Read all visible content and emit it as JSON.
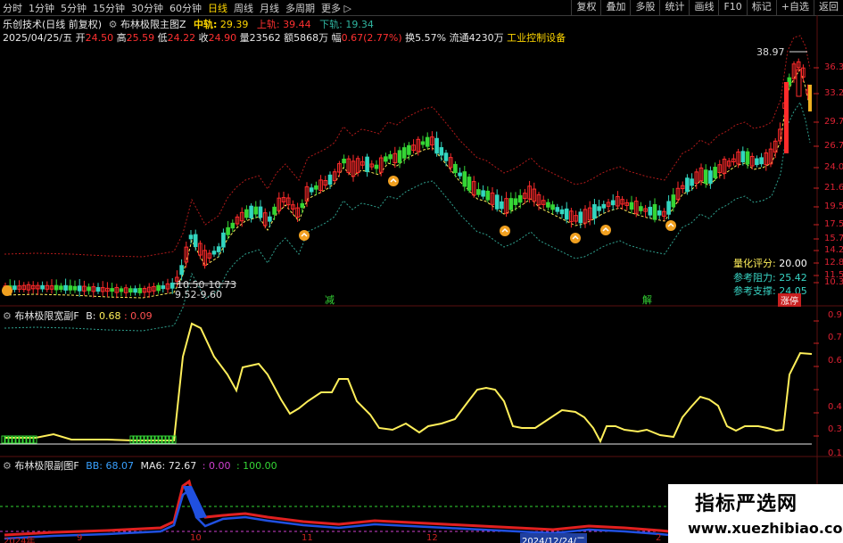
{
  "toolbar": {
    "periods": [
      "分时",
      "1分钟",
      "5分钟",
      "15分钟",
      "30分钟",
      "60分钟",
      "日线",
      "周线",
      "月线",
      "多周期",
      "更多 ▷"
    ],
    "active_index": 6,
    "actions": [
      "复权",
      "叠加",
      "多股",
      "统计",
      "画线",
      "F10",
      "标记",
      "+自选",
      "返回"
    ]
  },
  "main_header": {
    "stock": "乐创技术(日线 前复权)",
    "indicator": "布林极限主图Z",
    "mid_label": "中轨:",
    "mid_value": "29.39",
    "upper_label": "上轨:",
    "upper_value": "39.44",
    "lower_label": "下轨:",
    "lower_value": "19.34"
  },
  "quote_line": {
    "date": "2025/04/25/五",
    "open_label": "开",
    "open": "24.50",
    "high_label": "高",
    "high": "25.59",
    "low_label": "低",
    "low": "24.22",
    "close_label": "收",
    "close": "24.90",
    "vol_label": "量",
    "vol": "23562",
    "amt_label": "额",
    "amt": "5868万",
    "chg_label": "幅",
    "chg": "0.67",
    "chg_pct": "(2.77%)",
    "turnover_label": "换",
    "turnover": "5.57%",
    "float_label": "流通",
    "float_shares": "4230万",
    "industry": "工业控制设备"
  },
  "main_axis": [
    "36.3",
    "33.2",
    "29.7",
    "26.7",
    "24.0",
    "21.6",
    "19.5",
    "17.5",
    "15.7",
    "14.2",
    "12.8",
    "11.5",
    "10.3"
  ],
  "main_labels": {
    "peak": "38.97",
    "low_zone_a": "10.50-10.73",
    "low_zone_b": "9.52-9.60",
    "score_label": "量化评分:",
    "score_value": "20.00",
    "resist_label": "参考阻力:",
    "resist_value": "25.42",
    "support_label": "参考支撑:",
    "support_value": "24.05",
    "jian": "减",
    "jie": "解",
    "zhangting": "涨停"
  },
  "sub1_header": {
    "indicator": "布林极限宽副F",
    "b_label": "B:",
    "b_value": "0.68",
    "second_value": ": 0.09"
  },
  "sub1_axis": [
    "0.9",
    "0.7",
    "0.6",
    "0.4",
    "0.3",
    "0.1"
  ],
  "sub2_header": {
    "indicator": "布林极限副图F",
    "bb_label": "BB:",
    "bb_value": "68.07",
    "ma_label": "MA6:",
    "ma_value": "72.67",
    "v0": ": 0.00",
    "v100": ": 100.00"
  },
  "date_axis": [
    "2024年",
    "9",
    "10",
    "11",
    "12",
    "2024/12/24/二",
    "2"
  ],
  "watermark": {
    "title": "指标严选网",
    "url": "www.xuezhibiao.com"
  },
  "colors": {
    "up": "#ff2b2b",
    "down": "#33d6c0",
    "green": "#35d635",
    "yellow": "#ffef5a",
    "axis_red": "#cc2222",
    "active_tab": "#ffd700"
  }
}
